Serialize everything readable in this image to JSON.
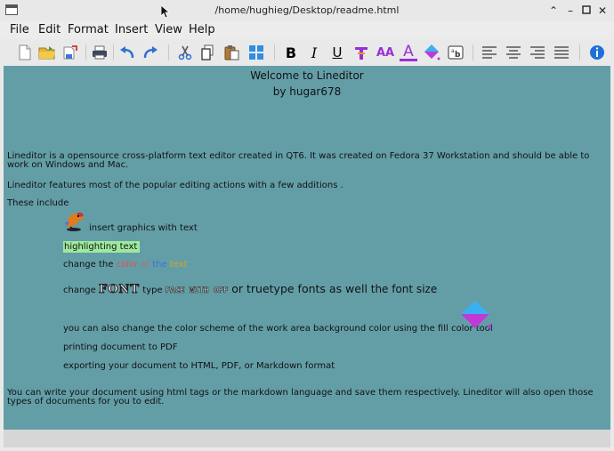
{
  "window": {
    "title": "/home/hughieg/Desktop/readme.html"
  },
  "menu": {
    "file": "File",
    "edit": "Edit",
    "format": "Format",
    "insert": "Insert",
    "view": "View",
    "help": "Help"
  },
  "toolbar": {
    "bold_label": "B",
    "italic_label": "I",
    "underline_label": "U",
    "font_size_label": "AA",
    "font_color_label": "A"
  },
  "document": {
    "heading1": "Welcome to Lineditor",
    "heading2": "by hugar678",
    "para1": "Lineditor is a opensource cross-platform text editor created in QT6. It was created on Fedora 37 Workstation and should be able to work on Windows and Mac.",
    "para2": "Lineditor features most of the popular editing actions with a few additions .",
    "para3": "These include",
    "item_graphics": "insert graphics with text",
    "item_highlight": "highlighting text",
    "item_color_prefix": "change the ",
    "item_color_words": [
      {
        "text": "color",
        "color": "#e05050"
      },
      {
        "text": " of ",
        "color": "#b07070"
      },
      {
        "text": "the",
        "color": "#3a6fe0"
      },
      {
        "text": " text",
        "color": "#d9a020"
      }
    ],
    "item_font_parts": [
      "change ",
      "FONT",
      " type ",
      "FACE WITH OFF",
      " or truetype fonts as well",
      " the font size"
    ],
    "item_fill": "you can also change the color scheme of the work area background color using the fill color tool",
    "item_pdf": "printing document to PDF",
    "item_export": "exporting your document to HTML, PDF, or Markdown format",
    "para4": "You can write your document using html tags or the markdown language and save them respectively. Lineditor will also open those types of documents for you to edit."
  },
  "colors": {
    "editor_bg": "#639ea7",
    "highlight_bg": "#9ee99e",
    "accent_purple": "#9b2fd6",
    "info_blue": "#1f6fd8"
  },
  "icons": [
    "new-file-icon",
    "open-folder-icon",
    "save-icon",
    "print-icon",
    "undo-icon",
    "redo-icon",
    "cut-icon",
    "copy-icon",
    "paste-icon",
    "select-all-icon",
    "bold-icon",
    "italic-icon",
    "underline-icon",
    "text-type-icon",
    "font-size-icon",
    "font-color-icon",
    "fill-color-icon",
    "find-replace-icon",
    "align-left-icon",
    "align-center-icon",
    "align-right-icon",
    "justify-icon",
    "info-icon"
  ]
}
